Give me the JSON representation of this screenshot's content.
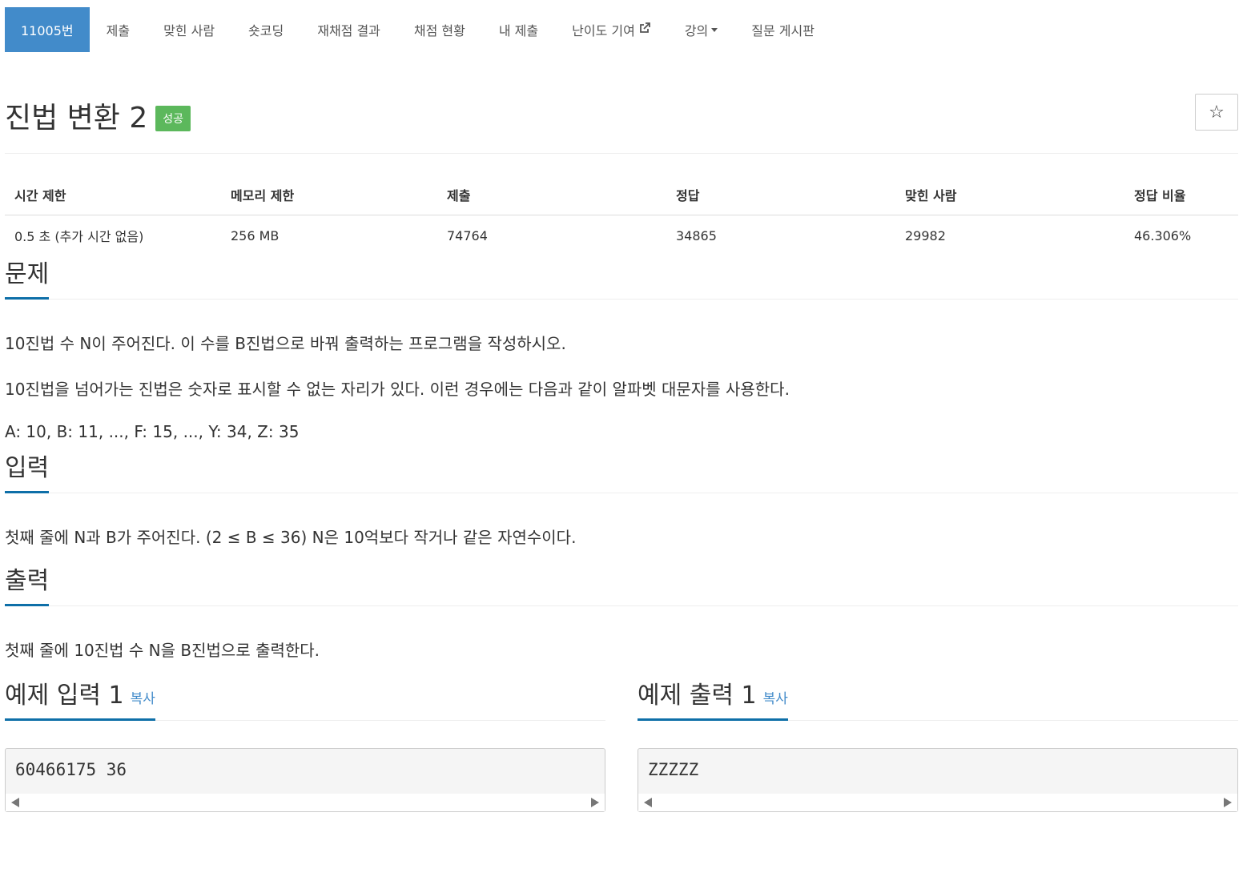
{
  "tabs": [
    {
      "label": "11005번",
      "active": true
    },
    {
      "label": "제출"
    },
    {
      "label": "맞힌 사람"
    },
    {
      "label": "숏코딩"
    },
    {
      "label": "재채점 결과"
    },
    {
      "label": "채점 현황"
    },
    {
      "label": "내 제출"
    },
    {
      "label": "난이도 기여"
    },
    {
      "label": "강의"
    },
    {
      "label": "질문 게시판"
    }
  ],
  "title": "진법 변환 2",
  "badge": "성공",
  "star": "☆",
  "info": {
    "headers": [
      "시간 제한",
      "메모리 제한",
      "제출",
      "정답",
      "맞힌 사람",
      "정답 비율"
    ],
    "values": [
      "0.5 초 (추가 시간 없음)",
      "256 MB",
      "74764",
      "34865",
      "29982",
      "46.306%"
    ]
  },
  "problem": {
    "heading": "문제",
    "paragraphs": [
      "10진법 수 N이 주어진다. 이 수를 B진법으로 바꿔 출력하는 프로그램을 작성하시오.",
      "10진법을 넘어가는 진법은 숫자로 표시할 수 없는 자리가 있다. 이런 경우에는 다음과 같이 알파벳 대문자를 사용한다.",
      "A: 10, B: 11, ..., F: 15, ..., Y: 34, Z: 35"
    ]
  },
  "input": {
    "heading": "입력",
    "text": "첫째 줄에 N과 B가 주어진다. (2 ≤ B ≤ 36) N은 10억보다 작거나 같은 자연수이다."
  },
  "output": {
    "heading": "출력",
    "text": "첫째 줄에 10진법 수 N을 B진법으로 출력한다."
  },
  "samples": {
    "input": {
      "heading": "예제 입력 1",
      "copy": "복사",
      "code": "60466175 36"
    },
    "output": {
      "heading": "예제 출력 1",
      "copy": "복사",
      "code": "ZZZZZ"
    }
  },
  "colors": {
    "accent": "#428bca",
    "success": "#5cb85c",
    "underline": "#0e6fa8"
  }
}
